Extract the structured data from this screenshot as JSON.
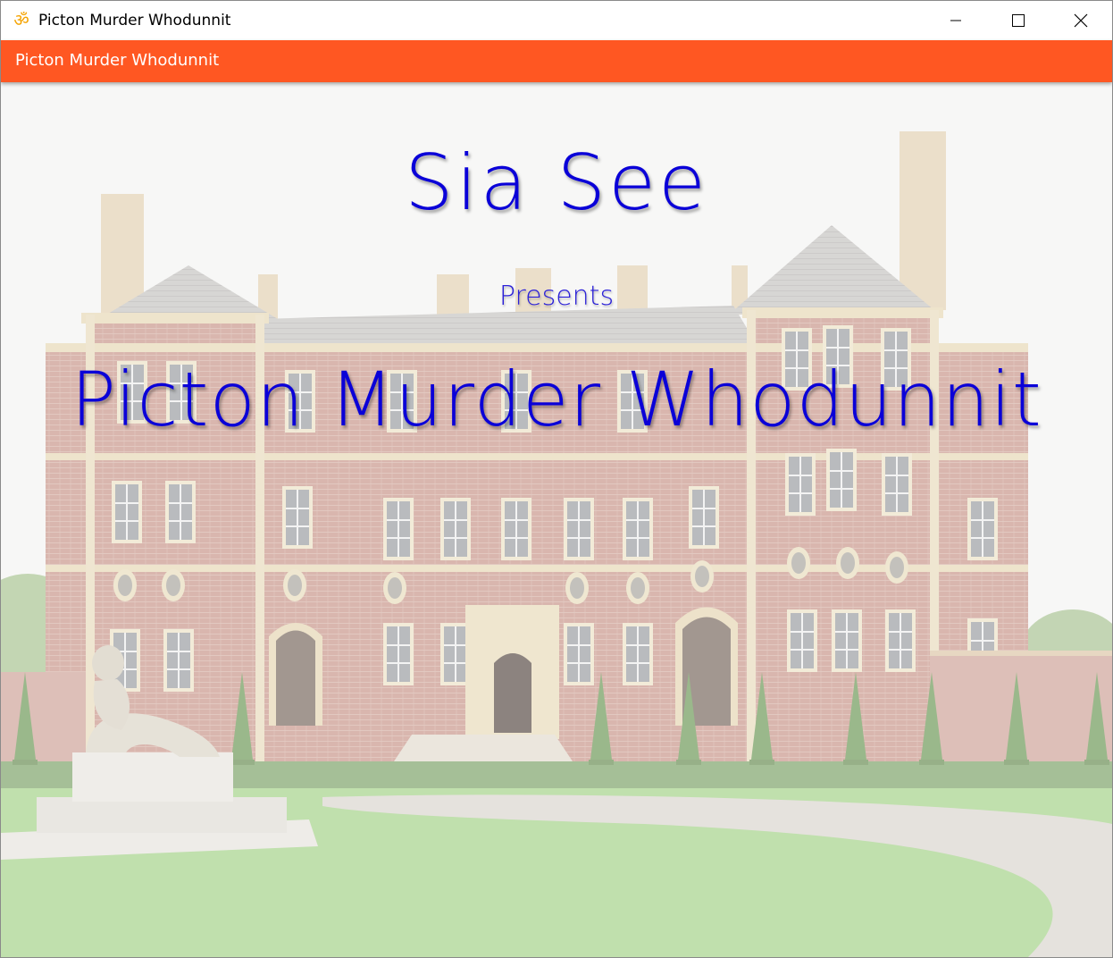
{
  "window": {
    "title": "Picton Murder Whodunnit",
    "icon": "om-symbol-icon",
    "controls": [
      "minimize-icon",
      "maximize-icon",
      "close-icon"
    ]
  },
  "appbar": {
    "title": "Picton Murder Whodunnit",
    "color": "#ff5722"
  },
  "splash": {
    "author": "Sia See",
    "presents": "Presents",
    "title": "Picton Murder Whodunnit",
    "text_color": "#0a00d8",
    "background": "faded-photo-of-red-brick-manor-house-with-garden-and-statue"
  }
}
